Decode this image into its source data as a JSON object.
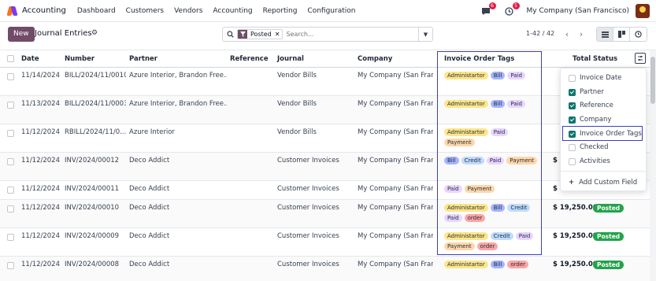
{
  "topbar": {
    "app_name": "Accounting",
    "nav": [
      "Dashboard",
      "Customers",
      "Vendors",
      "Accounting",
      "Reporting",
      "Configuration"
    ],
    "messages_count": "6",
    "activity_count": "5",
    "company": "My Company (San Francisco)"
  },
  "controls": {
    "new_label": "New",
    "title": "Journal Entries",
    "search_facet": "Posted",
    "search_placeholder": "Search...",
    "pager": "1-42 / 42"
  },
  "columns": {
    "date": "Date",
    "number": "Number",
    "partner": "Partner",
    "reference": "Reference",
    "journal": "Journal",
    "company": "Company",
    "tags": "Invoice Order Tags",
    "total": "Total",
    "status": "Status"
  },
  "tag_colors": {
    "Administartor": "#fde68a",
    "Bill": "#a5b4fc",
    "Paid": "#e9d5ff",
    "Payment": "#fed7aa",
    "Credit": "#bfdbfe",
    "order": "#fca5a5"
  },
  "rows": [
    {
      "date": "11/14/2024",
      "number": "BILL/2024/11/0010",
      "partner": "Azure Interior, Brandon Free...",
      "journal": "Vendor Bills",
      "company": "My Company (San Francis...",
      "tags": [
        "Administartor",
        "Bill",
        "Paid"
      ],
      "total": "",
      "status": ""
    },
    {
      "date": "11/13/2024",
      "number": "BILL/2024/11/0003",
      "partner": "Azure Interior, Brandon Free...",
      "journal": "Vendor Bills",
      "company": "My Company (San Francis...",
      "tags": [
        "Administartor",
        "Bill",
        "Paid"
      ],
      "total": "",
      "status": ""
    },
    {
      "date": "11/12/2024",
      "number": "RBILL/2024/11/0...",
      "partner": "Azure Interior",
      "journal": "Vendor Bills",
      "company": "My Company (San Francis...",
      "tags": [
        "Administartor",
        "Paid",
        "Payment"
      ],
      "total": "",
      "status": ""
    },
    {
      "date": "11/12/2024",
      "number": "INV/2024/00012",
      "partner": "Deco Addict",
      "journal": "Customer Invoices",
      "company": "My Company (San Francis...",
      "tags": [
        "Bill",
        "Credit",
        "Paid",
        "Payment"
      ],
      "total": "$",
      "status": ""
    },
    {
      "date": "11/12/2024",
      "number": "INV/2024/00011",
      "partner": "Deco Addict",
      "journal": "Customer Invoices",
      "company": "My Company (San Francis...",
      "tags": [
        "Paid",
        "Payment"
      ],
      "total": "$",
      "status": ""
    },
    {
      "date": "11/12/2024",
      "number": "INV/2024/00010",
      "partner": "Deco Addict",
      "journal": "Customer Invoices",
      "company": "My Company (San Francis...",
      "tags": [
        "Administartor",
        "Bill",
        "Credit",
        "Paid",
        "order"
      ],
      "total": "$ 19,250.00",
      "status": "Posted"
    },
    {
      "date": "11/12/2024",
      "number": "INV/2024/00009",
      "partner": "Deco Addict",
      "journal": "Customer Invoices",
      "company": "My Company (San Francis...",
      "tags": [
        "Administartor",
        "Credit",
        "Paid",
        "Payment",
        "order"
      ],
      "total": "$ 19,250.00",
      "status": "Posted"
    },
    {
      "date": "11/12/2024",
      "number": "INV/2024/00008",
      "partner": "Deco Addict",
      "journal": "Customer Invoices",
      "company": "My Company (San Francis...",
      "tags": [
        "Administartor",
        "Bill",
        "order"
      ],
      "total": "$ 19,250.00",
      "status": "Posted"
    }
  ],
  "column_menu": {
    "items": [
      {
        "label": "Invoice Date",
        "checked": false
      },
      {
        "label": "Partner",
        "checked": true
      },
      {
        "label": "Reference",
        "checked": true
      },
      {
        "label": "Company",
        "checked": true
      },
      {
        "label": "Invoice Order Tags",
        "checked": true
      },
      {
        "label": "Checked",
        "checked": false
      },
      {
        "label": "Activities",
        "checked": false
      }
    ],
    "add_custom_field": "Add Custom Field"
  },
  "colors": {
    "brand": "#714b67",
    "posted": "#22a34a",
    "highlight": "#3b3fbf",
    "checkbox_checked": "#0f766e"
  }
}
